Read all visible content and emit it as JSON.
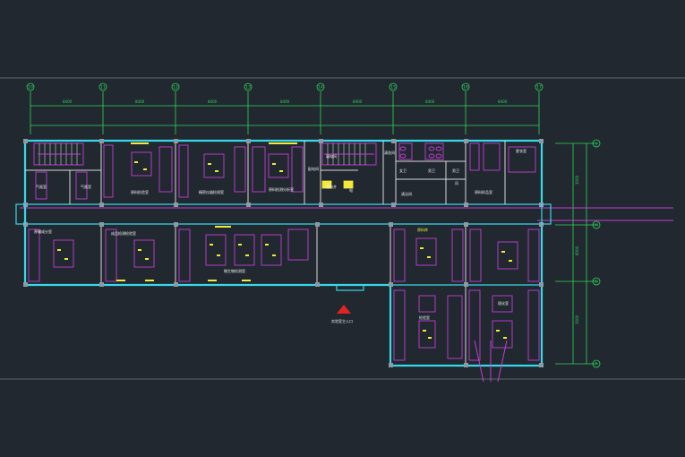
{
  "drawing": {
    "background": "#212830",
    "colors": {
      "walls": "#37d9e8",
      "dimensions": "#2fd65a",
      "furniture": "#c43ed6",
      "fixtures": "#f2e93a",
      "partitions": "#d8d8d8"
    },
    "top_axes": [
      "10",
      "11",
      "12",
      "13",
      "14",
      "15",
      "16",
      "17"
    ],
    "right_axes": [
      "J",
      "H",
      "G",
      "F"
    ],
    "top_dimensions": [
      "8400",
      "8400",
      "8400",
      "8400",
      "8400",
      "8400",
      "8400"
    ],
    "right_dimensions": [
      "3000",
      "6000",
      "3000"
    ],
    "entrance_label": "实验室主入口",
    "rooms": {
      "r1": "气瓶室",
      "r2": "气瓶室",
      "r3": "原料检验室",
      "r4": "精密仪器检测室",
      "r5": "原料检测分析室",
      "r6": "配电间",
      "r7": "弱电间",
      "r8": "强电井",
      "r9": "电",
      "r10": "清洗间",
      "r11": "女卫",
      "r12": "男卫",
      "r13": "清洁间",
      "r14": "男卫",
      "r15": "风",
      "r16": "原料样品室",
      "r17": "更衣室",
      "r18": "原辅成分室",
      "r19": "成品检测检验室",
      "r20": "微生物检测室",
      "r21": "原料库",
      "r22": "检验室",
      "r23": "理化室"
    }
  }
}
